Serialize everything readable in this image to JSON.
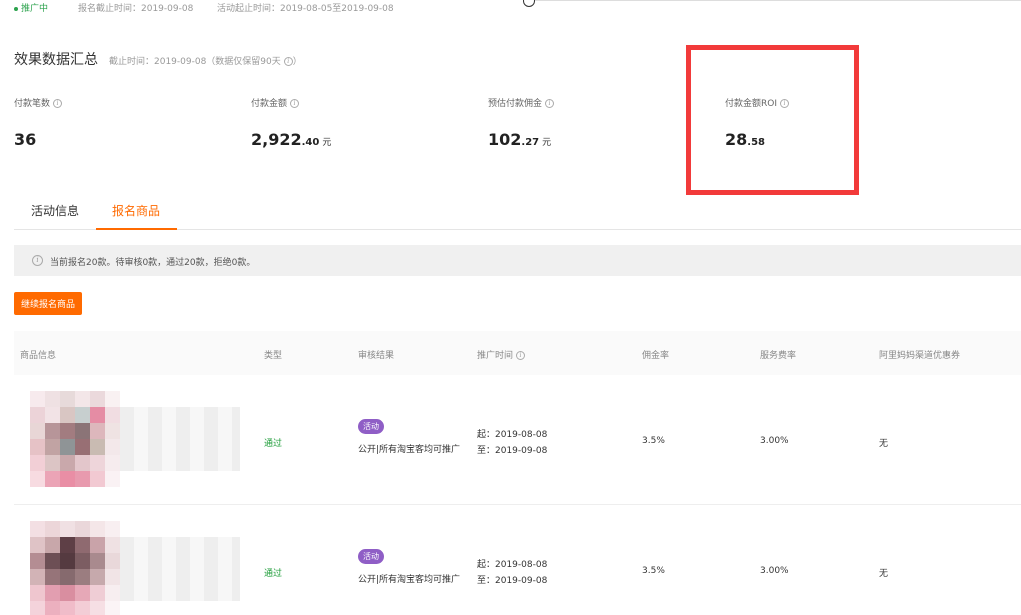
{
  "topbar": {
    "status": "推广中",
    "deadline": "报名截止时间：2019-09-08",
    "period": "活动起止时间：2019-08-05至2019-09-08"
  },
  "summary": {
    "title": "效果数据汇总",
    "note": "截止时间：2019-09-08（数据仅保留90天",
    "note_end": "）",
    "metrics": [
      {
        "label": "付款笔数",
        "int": "36",
        "dec": "",
        "unit": ""
      },
      {
        "label": "付款金额",
        "int": "2,922",
        "dec": ".40",
        "unit": "元"
      },
      {
        "label": "预估付款佣金",
        "int": "102",
        "dec": ".27",
        "unit": "元"
      },
      {
        "label": "付款金额ROI",
        "int": "28",
        "dec": ".58",
        "unit": ""
      }
    ]
  },
  "tabs": [
    {
      "label": "活动信息",
      "active": false
    },
    {
      "label": "报名商品",
      "active": true
    }
  ],
  "notice": "当前报名20款。待审核0款，通过20款，拒绝0款。",
  "button_label": "继续报名商品",
  "table": {
    "headers": [
      "商品信息",
      "类型",
      "审核结果",
      "推广时间",
      "佣金率",
      "服务费率",
      "阿里妈妈渠道优惠券"
    ],
    "rows": [
      {
        "type": "通过",
        "tag": "活动",
        "audit_desc": "公开|所有淘宝客均可推广",
        "start": "起：2019-08-08",
        "end": "至：2019-09-08",
        "rate": "3.5%",
        "fee": "3.00%",
        "coupon": "无"
      },
      {
        "type": "通过",
        "tag": "活动",
        "audit_desc": "公开|所有淘宝客均可推广",
        "start": "起：2019-08-08",
        "end": "至：2019-09-08",
        "rate": "3.5%",
        "fee": "3.00%",
        "coupon": "无"
      }
    ]
  },
  "colors": {
    "accent": "#ff6a00",
    "success": "#1f9d3a",
    "tag": "#8f5ec6",
    "highlight": "#f23a3a"
  }
}
